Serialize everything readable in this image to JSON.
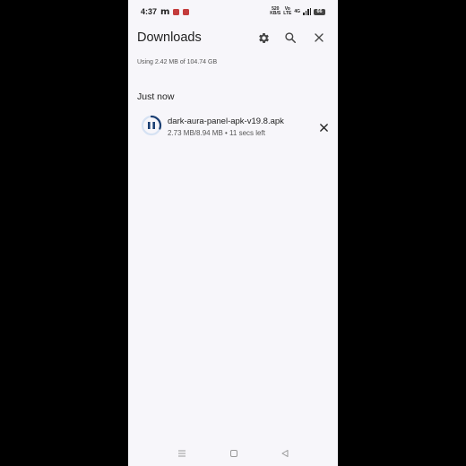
{
  "status_bar": {
    "time": "4:37",
    "notification_letter": "m",
    "speed_value": "520",
    "speed_unit": "KB/S",
    "net_top": "Vo",
    "net_bottom": "LTE",
    "net_type": "4G",
    "battery": "66"
  },
  "header": {
    "title": "Downloads",
    "settings_icon": "gear-icon",
    "search_icon": "search-icon",
    "close_icon": "close-icon"
  },
  "storage_text": "Using 2.42 MB of 104.74 GB",
  "section_title": "Just now",
  "downloads": [
    {
      "name": "dark-aura-panel-apk-v19.8.apk",
      "meta": "2.73 MB/8.94 MB • 11 secs left",
      "progress": 0.305,
      "state_icon": "pause-icon",
      "cancel_icon": "close-icon"
    }
  ],
  "nav": {
    "menu_icon": "menu-icon",
    "home_icon": "home-icon",
    "back_icon": "back-icon"
  },
  "colors": {
    "accent": "#1a73e8",
    "progress_dark": "#1b3f73",
    "background": "#f7f6fa"
  }
}
